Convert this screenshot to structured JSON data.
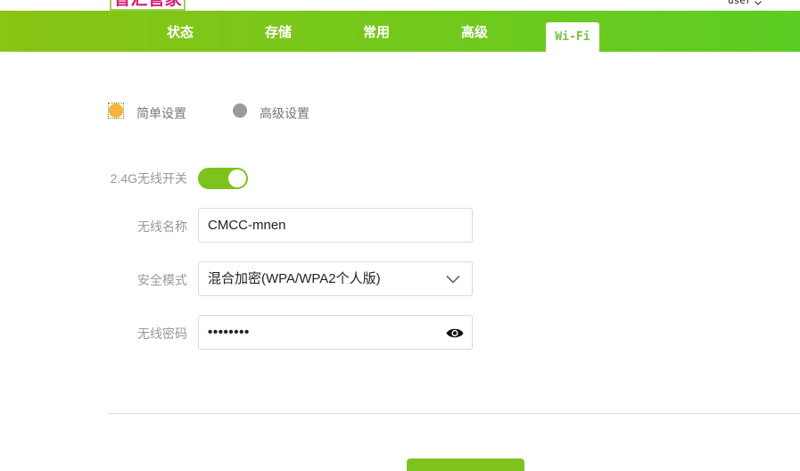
{
  "header": {
    "logo_text": "智汇管家",
    "user_label": "user",
    "user_menu_icon": "chevron-down-icon"
  },
  "nav": {
    "items": [
      {
        "label": "状态",
        "active": false
      },
      {
        "label": "存储",
        "active": false
      },
      {
        "label": "常用",
        "active": false
      },
      {
        "label": "高级",
        "active": false
      },
      {
        "label": "Wi-Fi",
        "active": true
      }
    ]
  },
  "mode": {
    "options": [
      {
        "label": "简单设置",
        "selected": true
      },
      {
        "label": "高级设置",
        "selected": false
      }
    ]
  },
  "form": {
    "switch_label": "2.4G无线开关",
    "switch_on": true,
    "ssid_label": "无线名称",
    "ssid_value": "CMCC-mnen",
    "security_label": "安全模式",
    "security_value": "混合加密(WPA/WPA2个人版)",
    "security_icon": "chevron-down-icon",
    "password_label": "无线密码",
    "password_value": "••••••••",
    "password_icon": "eye-icon"
  },
  "colors": {
    "nav_start": "#8ac414",
    "nav_end": "#5ccd23",
    "accent": "#7ec31d",
    "radio_selected": "#f3b33d",
    "radio_idle": "#9a9a9a",
    "logo": "#d81b77",
    "tab_text": "#76c043"
  }
}
